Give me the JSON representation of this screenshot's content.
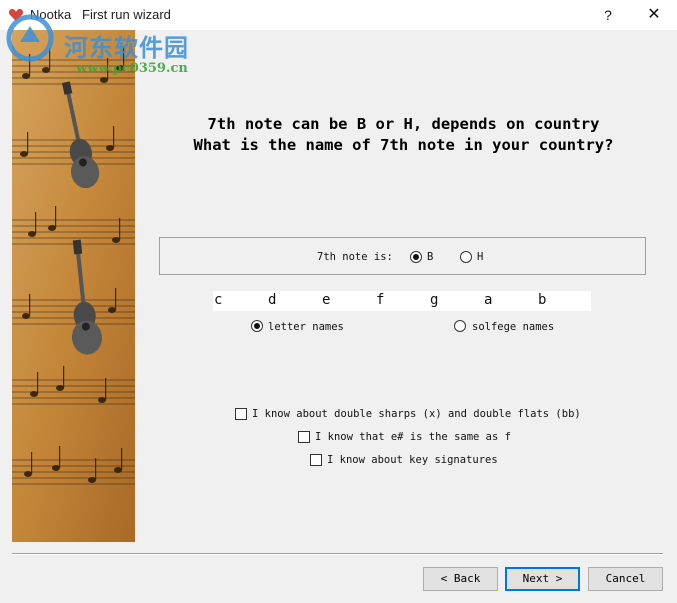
{
  "window": {
    "title": "Nootka   First run wizard",
    "help_label": "?",
    "close_label": "✕",
    "app_icon": "heart-note-icon"
  },
  "watermark": {
    "title": "河东软件园",
    "url": "www.pc0359.cn"
  },
  "question": {
    "line1": "7th note can be B or H, depends on country",
    "line2": "What is the name of 7th note in your country?"
  },
  "seventh_note": {
    "label": "7th note is:",
    "options": [
      "B",
      "H"
    ],
    "selected": "B"
  },
  "note_names": [
    "c",
    "d",
    "e",
    "f",
    "g",
    "a",
    "b"
  ],
  "naming": {
    "options": [
      "letter names",
      "solfege names"
    ],
    "selected": "letter names"
  },
  "checkboxes": [
    {
      "label": "I know about double sharps (x) and double flats (bb)",
      "checked": false
    },
    {
      "label": "I know that e# is the same as f",
      "checked": false
    },
    {
      "label": "I know about key signatures",
      "checked": false
    }
  ],
  "buttons": {
    "back": "< Back",
    "next": "Next >",
    "cancel": "Cancel"
  },
  "colors": {
    "window_bg": "#f0f0f0",
    "accent": "#0078d7",
    "side_image": "#c48a3a"
  }
}
